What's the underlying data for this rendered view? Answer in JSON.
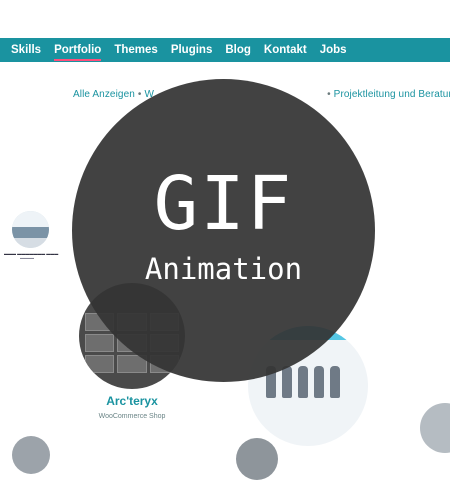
{
  "nav": {
    "items": [
      {
        "label": "Skills"
      },
      {
        "label": "Portfolio",
        "active": true
      },
      {
        "label": "Themes"
      },
      {
        "label": "Plugins"
      },
      {
        "label": "Blog"
      },
      {
        "label": "Kontakt"
      },
      {
        "label": "Jobs"
      }
    ],
    "background": "#1a93a0",
    "active_underline": "#ff4f7b"
  },
  "filter": {
    "show_all": "Alle Anzeigen",
    "partial": "W",
    "consulting": "Projektleitung und Beratung",
    "separator": "•"
  },
  "portfolio": {
    "arcteryx_title": "Arc'teryx",
    "arcteryx_subtitle": "WooCommerce Shop"
  },
  "overlay": {
    "title": "GIF",
    "subtitle": "Animation"
  }
}
